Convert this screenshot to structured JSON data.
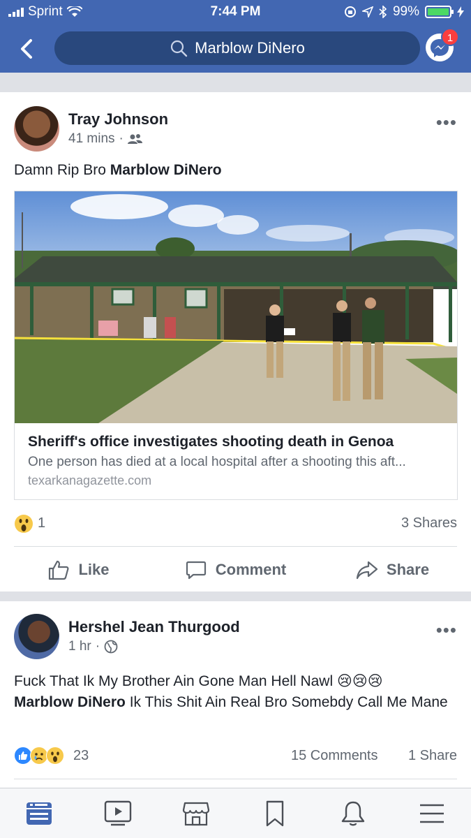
{
  "status_bar": {
    "carrier": "Sprint",
    "time": "7:44 PM",
    "battery": "99%"
  },
  "header": {
    "back_icon": "chevron-left-icon",
    "search_text": "Marblow DiNero",
    "messenger_badge": "1"
  },
  "posts": [
    {
      "author": "Tray Johnson",
      "time": "41 mins",
      "audience_icon": "friends-icon",
      "text_prefix": "Damn Rip Bro ",
      "text_tag": "Marblow DiNero",
      "link": {
        "title": "Sheriff's office investigates shooting death in Genoa",
        "description": "One person has died at a local hospital after a shooting this aft...",
        "domain": "texarkanagazette.com"
      },
      "reaction_count": "1",
      "shares": "3 Shares",
      "actions": {
        "like": "Like",
        "comment": "Comment",
        "share": "Share"
      }
    },
    {
      "author": "Hershel Jean Thurgood",
      "time": "1 hr",
      "audience_icon": "globe-icon",
      "text_line1": "Fuck That Ik My Brother Ain Gone Man Hell Nawl 😢😢😢",
      "text_tag": "Marblow DiNero",
      "text_rest": " Ik This Shit Ain Real Bro Somebdy Call Me Mane",
      "reaction_count": "23",
      "comments": "15 Comments",
      "shares": "1 Share"
    }
  ],
  "tabbar": [
    "news-feed-icon",
    "watch-icon",
    "marketplace-icon",
    "saved-icon",
    "notifications-icon",
    "menu-icon"
  ],
  "colors": {
    "brand": "#4267b2",
    "search": "#29487d",
    "badge": "#fa3e3e",
    "battery": "#4cd964"
  }
}
